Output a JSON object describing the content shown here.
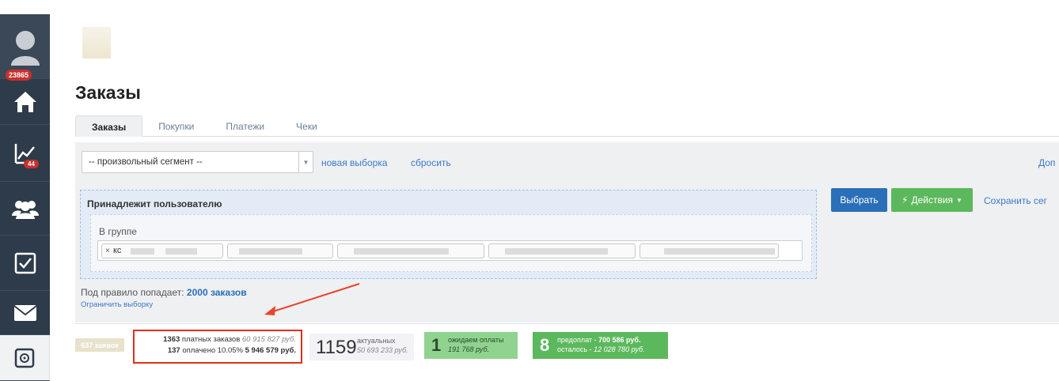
{
  "sidebar": {
    "avatar_badge": "23865",
    "chart_badge": "44",
    "items": [
      {
        "icon": "user-avatar-icon"
      },
      {
        "icon": "home-icon"
      },
      {
        "icon": "chart-icon"
      },
      {
        "icon": "users-icon"
      },
      {
        "icon": "checkbox-icon"
      },
      {
        "icon": "mail-icon"
      },
      {
        "icon": "safe-icon"
      }
    ]
  },
  "page": {
    "title": "Заказы"
  },
  "tabs": [
    {
      "label": "Заказы",
      "active": true
    },
    {
      "label": "Покупки",
      "active": false
    },
    {
      "label": "Платежи",
      "active": false
    },
    {
      "label": "Чеки",
      "active": false
    }
  ],
  "filter": {
    "segment_value": "-- произвольный сегмент --",
    "new_selection": "новая выборка",
    "reset": "сбросить",
    "right_link": "Доп",
    "rule_title": "Принадлежит пользователю",
    "group_label": "В группе",
    "first_tag_text": "кс",
    "select_button": "Выбрать",
    "actions_button": "Действия",
    "save_link": "Сохранить сег",
    "rule_count_prefix": "Под правило попадает:",
    "rule_count_value": "2000 заказов",
    "limit_link": "Ограничить выборку"
  },
  "stats": {
    "requests": "637 заявок",
    "paid_count": "1363",
    "paid_label": "платных заказов",
    "paid_sum": "60 915 827 руб.",
    "payed_count": "137",
    "payed_label": "оплачено 10.05%",
    "payed_sum": "5 946 579 руб.",
    "actual_count": "1159",
    "actual_label": "актуальных",
    "actual_sum": "50 693 233 руб.",
    "wait_count": "1",
    "wait_label": "ожидаем оплаты",
    "wait_sum": "191 768 руб.",
    "prepay_count": "8",
    "prepay_label": "предоплат -",
    "prepay_sum": "700 586 руб.",
    "remain_label": "осталось -",
    "remain_sum": "12 028 780 руб."
  },
  "colors": {
    "sidebar": "#2e3b4a",
    "badge": "#c9302c",
    "primary": "#2a6fb8",
    "success": "#5cb85c",
    "highlight": "#e02e1b"
  }
}
